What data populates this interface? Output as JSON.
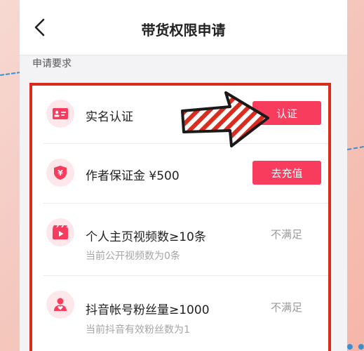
{
  "header": {
    "title": "带货权限申请"
  },
  "section": {
    "label": "申请要求"
  },
  "requirements": [
    {
      "icon": "id-card-icon",
      "title": "实名认证",
      "action": "认证"
    },
    {
      "icon": "shield-yen-icon",
      "title": "作者保证金 ¥500",
      "action": "去充值"
    },
    {
      "icon": "video-icon",
      "title": "个人主页视频数≥10条",
      "status": "不满足",
      "sub": "当前公开视频数为0条"
    },
    {
      "icon": "fans-icon",
      "title": "抖音帐号粉丝量≥1000",
      "status": "不满足",
      "sub": "当前抖音有效粉丝数为1"
    }
  ],
  "colors": {
    "accent": "#f73c5d",
    "highlight_border": "#d92c1f",
    "icon_bg": "#fde7ea"
  }
}
